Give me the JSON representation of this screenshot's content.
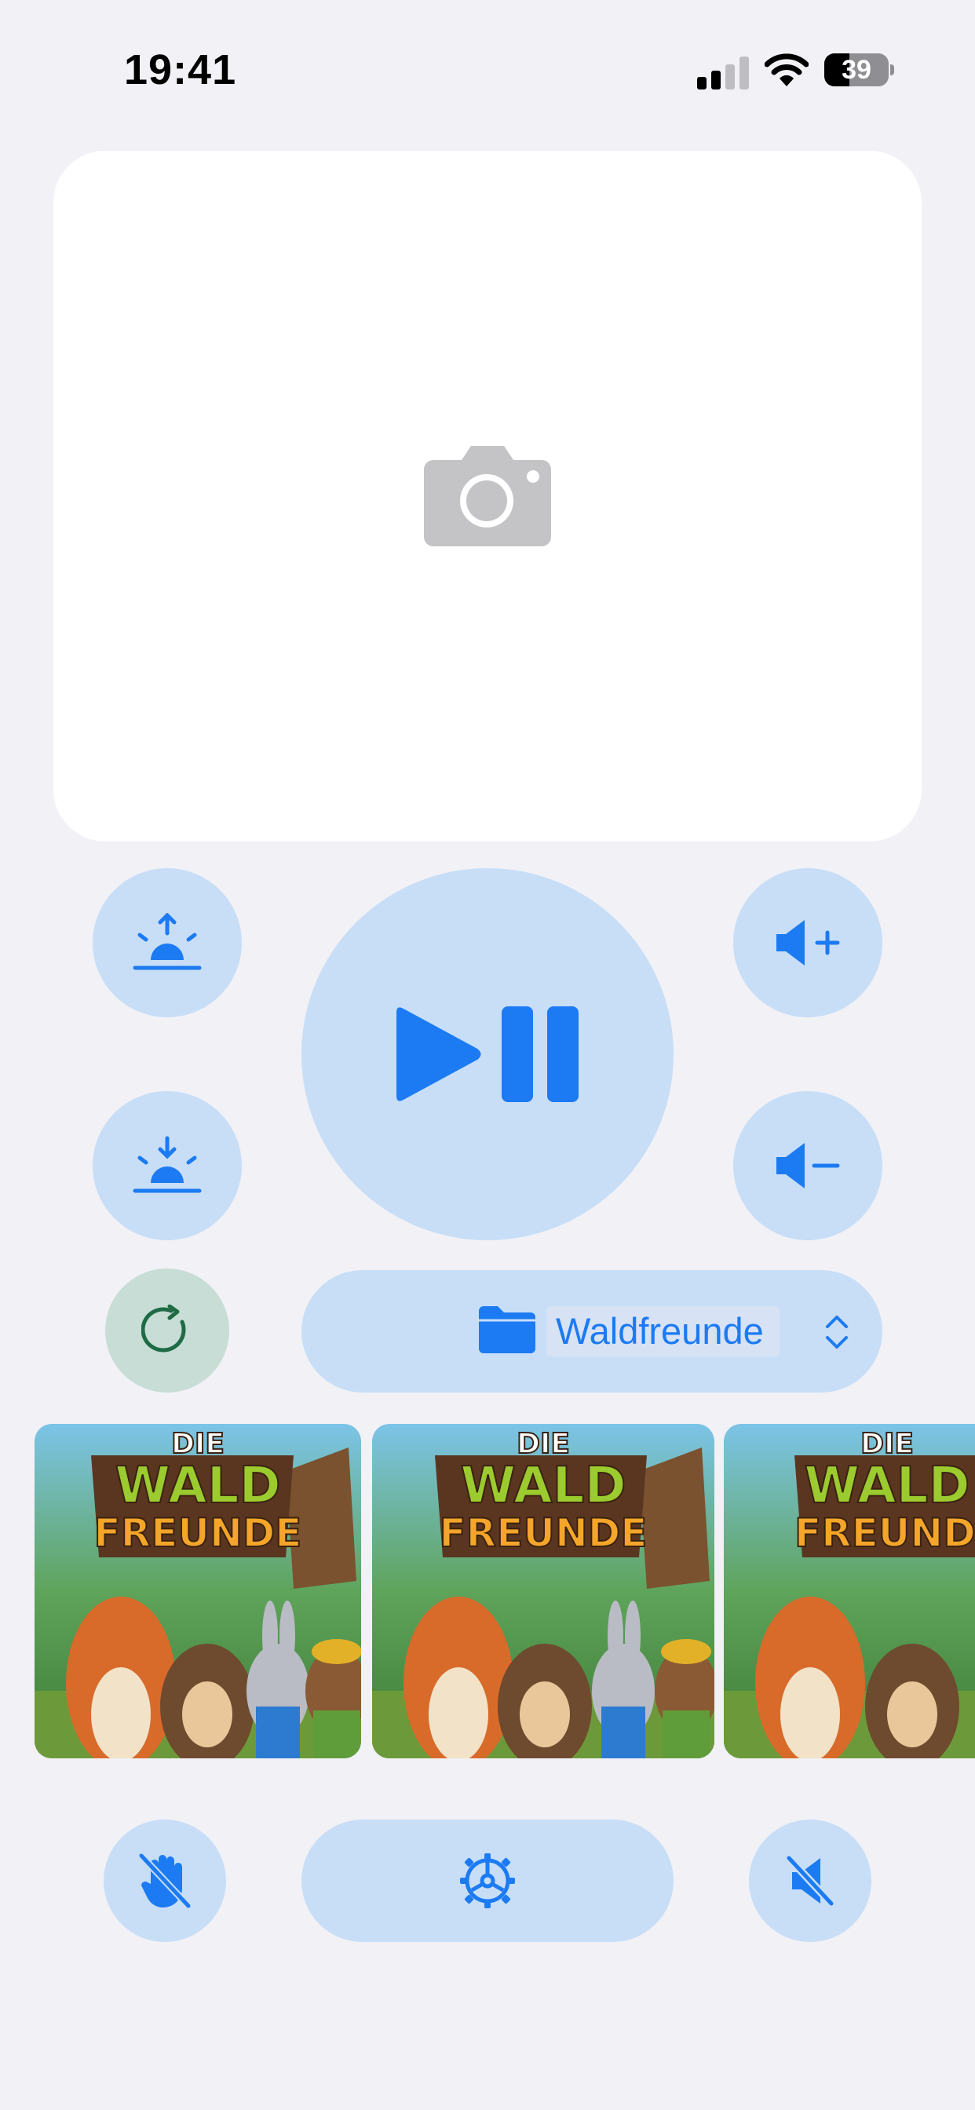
{
  "status_bar": {
    "time": "19:41",
    "battery_level": "39",
    "signal_bars_active": 2,
    "signal_bars_total": 4,
    "battery_fraction": 0.39,
    "icons": [
      "signal-icon",
      "wifi-icon",
      "battery-icon"
    ]
  },
  "camera": {
    "icon": "camera-icon",
    "placeholder_color": "#C4C4C6"
  },
  "controls": {
    "brightness_up_icon": "sunrise-arrow-up-icon",
    "brightness_down_icon": "sunset-arrow-down-icon",
    "play_pause_icon": "play-pause-icon",
    "volume_up_icon": "speaker-plus-icon",
    "volume_down_icon": "speaker-minus-icon",
    "refresh_icon": "refresh-icon"
  },
  "folder_selector": {
    "icon": "folder-icon",
    "selected": "Waldfreunde",
    "chevron_icon": "chevron-up-down-icon"
  },
  "covers": [
    {
      "line1": "DIE",
      "line2": "WALD",
      "line3": "FREUNDE"
    },
    {
      "line1": "DIE",
      "line2": "WALD",
      "line3": "FREUNDE"
    },
    {
      "line1": "DIE",
      "line2": "WALD",
      "line3": "FREUNDE"
    }
  ],
  "bottom_bar": {
    "hand_icon": "hand-slash-icon",
    "settings_icon": "gear-icon",
    "mute_icon": "speaker-slash-icon"
  },
  "colors": {
    "accent": "#1C7BF2",
    "button_bg": "#C8DEF7",
    "refresh_bg": "#C7DDD6",
    "refresh_icon": "#1E6B45",
    "background": "#F1F1F6"
  }
}
